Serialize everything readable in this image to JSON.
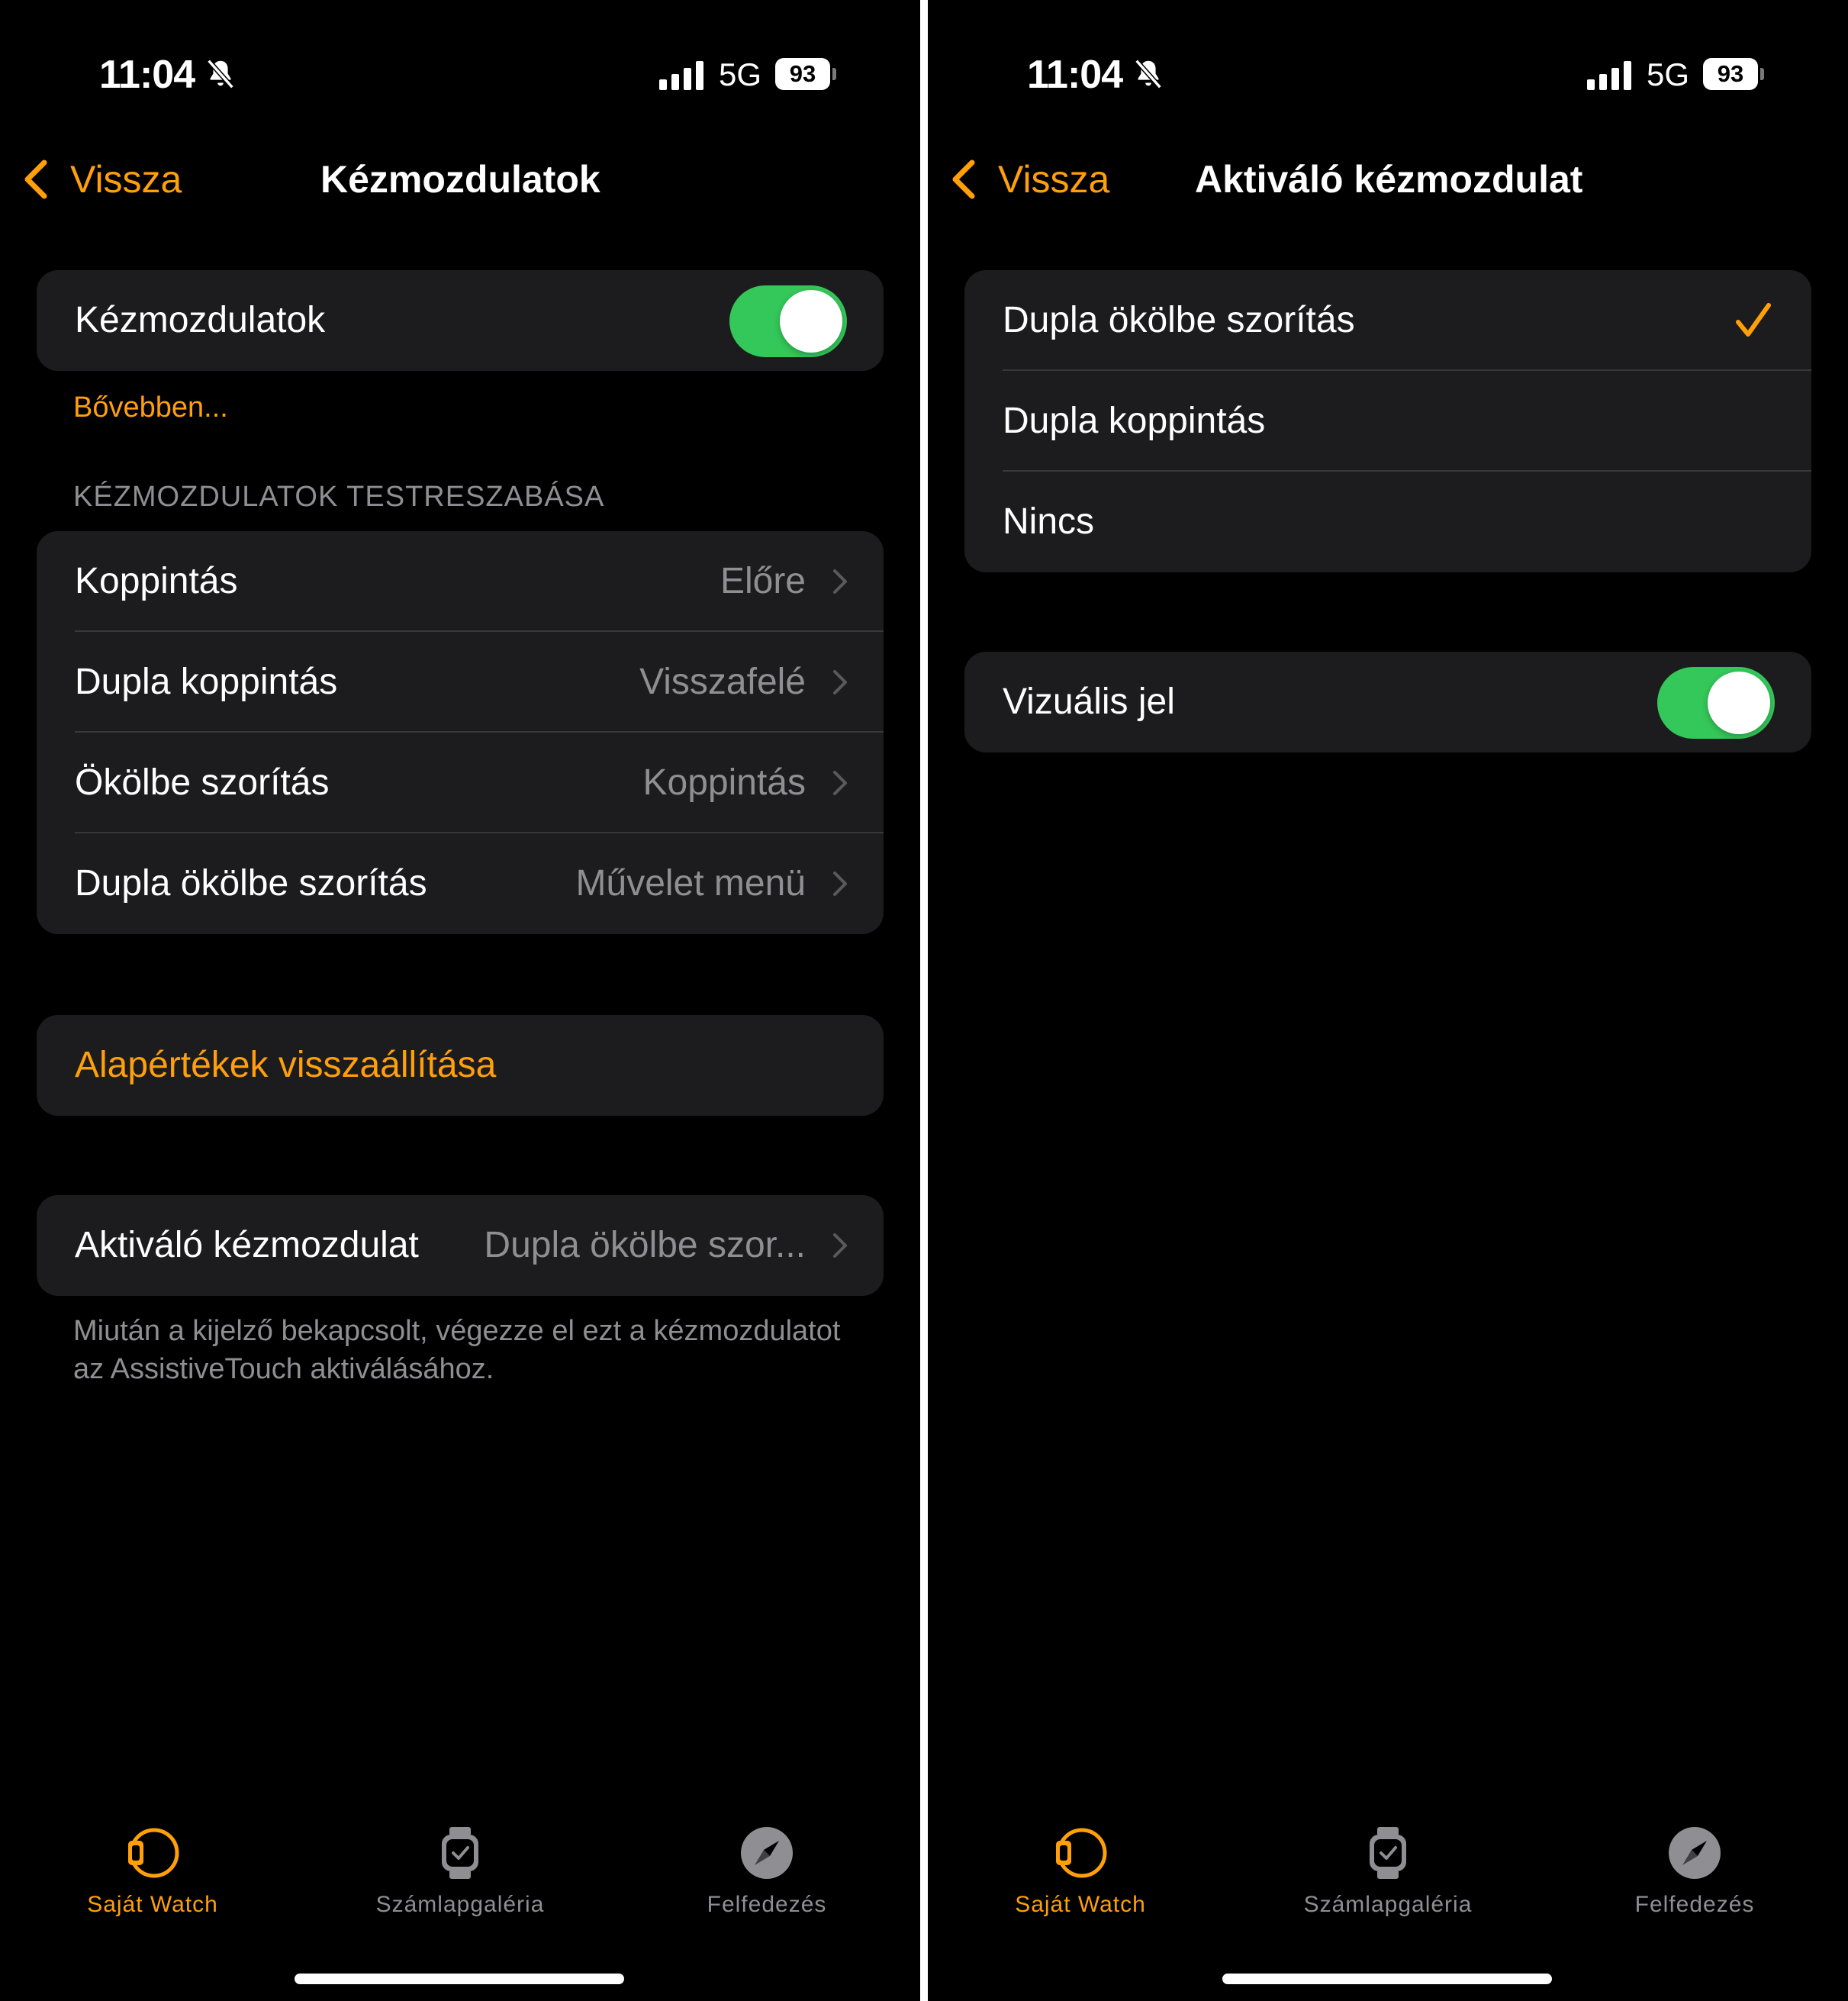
{
  "status_bar": {
    "time": "11:04",
    "network": "5G",
    "battery": "93"
  },
  "left_screen": {
    "nav": {
      "back_label": "Vissza",
      "title": "Kézmozdulatok"
    },
    "main_toggle": {
      "label": "Kézmozdulatok",
      "enabled": true
    },
    "learn_more": "Bővebben...",
    "section_header": "KÉZMOZDULATOK TESTRESZABÁSA",
    "custom_rows": [
      {
        "label": "Koppintás",
        "value": "Előre"
      },
      {
        "label": "Dupla koppintás",
        "value": "Visszafelé"
      },
      {
        "label": "Ökölbe szorítás",
        "value": "Koppintás"
      },
      {
        "label": "Dupla ökölbe szorítás",
        "value": "Művelet menü"
      }
    ],
    "reset_label": "Alapértékek visszaállítása",
    "activation": {
      "label": "Aktiváló kézmozdulat",
      "value": "Dupla ökölbe szor..."
    },
    "footer": "Miután a kijelző bekapcsolt, végezze el ezt a kézmozdulatot az AssistiveTouch aktiválásához."
  },
  "right_screen": {
    "nav": {
      "back_label": "Vissza",
      "title": "Aktiváló kézmozdulat"
    },
    "options": [
      {
        "label": "Dupla ökölbe szorítás",
        "selected": true
      },
      {
        "label": "Dupla koppintás",
        "selected": false
      },
      {
        "label": "Nincs",
        "selected": false
      }
    ],
    "visual_cue": {
      "label": "Vizuális jel",
      "enabled": true
    }
  },
  "tab_bar": [
    {
      "label": "Saját Watch",
      "icon": "watch-band-icon",
      "active": true
    },
    {
      "label": "Számlapgaléria",
      "icon": "watch-face-icon",
      "active": false
    },
    {
      "label": "Felfedezés",
      "icon": "compass-icon",
      "active": false
    }
  ],
  "colors": {
    "accent": "#ff9f0a",
    "toggle_on": "#34c759",
    "cell_bg": "#1c1c1e",
    "secondary_text": "#8e8e93"
  }
}
